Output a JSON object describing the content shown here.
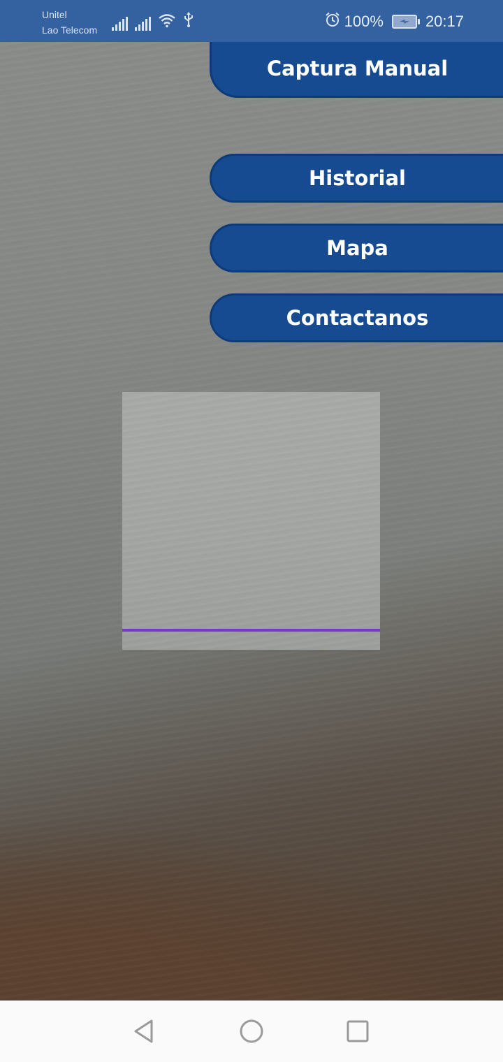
{
  "status_bar": {
    "carrier_1": "Unitel",
    "carrier_2": "Lao Telecom",
    "battery_percent": "100%",
    "time": "20:17",
    "icons": [
      "signal-icon",
      "signal-icon",
      "wifi-icon",
      "usb-icon",
      "alarm-icon",
      "battery-charging-icon"
    ]
  },
  "menu": {
    "captura_manual": "Captura Manual",
    "historial": "Historial",
    "mapa": "Mapa",
    "contactanos": "Contactanos"
  },
  "scanner": {
    "scan_line_color": "#7a35cc"
  },
  "nav_bar": {
    "icons": [
      "back-icon",
      "home-icon",
      "recents-icon"
    ]
  },
  "colors": {
    "status_bar": "#3461a0",
    "button_fill": "#164b92",
    "button_border": "#0d3a78"
  }
}
